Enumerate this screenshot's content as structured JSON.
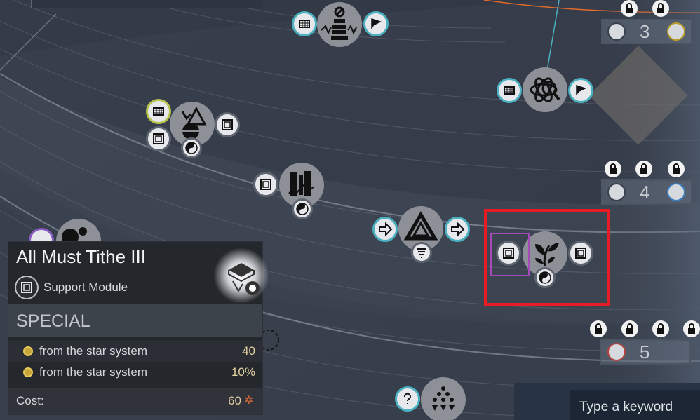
{
  "tooltip": {
    "title": "All Must Tithe III",
    "module_label": "Support Module",
    "section": "SPECIAL",
    "effects": [
      {
        "label": "from the star system",
        "value": "40"
      },
      {
        "label": "from the star system",
        "value": "10%"
      }
    ],
    "cost_label": "Cost:",
    "cost_value": "60"
  },
  "tiers": [
    {
      "number": "3"
    },
    {
      "number": "4"
    },
    {
      "number": "5"
    }
  ],
  "search": {
    "placeholder": "Type a keyword"
  },
  "icons": {
    "tech_nodes": [
      "census-icon",
      "obelisk-icon",
      "flag-icon",
      "atom-eye-icon",
      "flag-icon",
      "census-icon",
      "pyramid-icon",
      "yin-yang-icon",
      "cube-icon",
      "fortress-icon",
      "triangle-tech-icon",
      "arrow-right-icon",
      "plant-tech-icon",
      "dots-tech-icon",
      "question-icon"
    ]
  },
  "colors": {
    "selection_outline": "#e81c24",
    "sub_selection": "#a64ab8",
    "teal_ring": "#4bb1c0",
    "cost_accent": "#c7643a"
  }
}
